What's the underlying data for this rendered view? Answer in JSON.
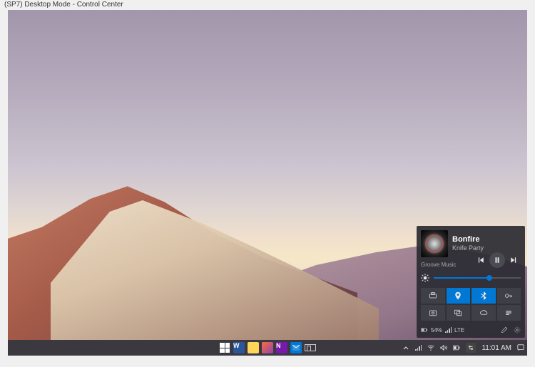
{
  "window_title": "(SP7) Desktop Mode - Control Center",
  "media": {
    "track": "Bonfire",
    "artist": "Knife Party",
    "app": "Groove Music"
  },
  "brightness_percent": 64,
  "quick_actions": [
    {
      "name": "network-share",
      "active": false
    },
    {
      "name": "location",
      "active": true
    },
    {
      "name": "bluetooth",
      "active": true
    },
    {
      "name": "vpn-key",
      "active": false
    },
    {
      "name": "screenshot",
      "active": false
    },
    {
      "name": "project",
      "active": false
    },
    {
      "name": "cloud-sync",
      "active": false
    },
    {
      "name": "action",
      "active": false
    }
  ],
  "battery": {
    "percent_label": "54%"
  },
  "signal": {
    "network_type": "LTE"
  },
  "taskbar": {
    "pinned": [
      "start",
      "word",
      "files",
      "photos",
      "onenote",
      "mail",
      "taskview"
    ]
  },
  "tray": {
    "network_type": "LTE",
    "clock": "11:01 AM"
  }
}
